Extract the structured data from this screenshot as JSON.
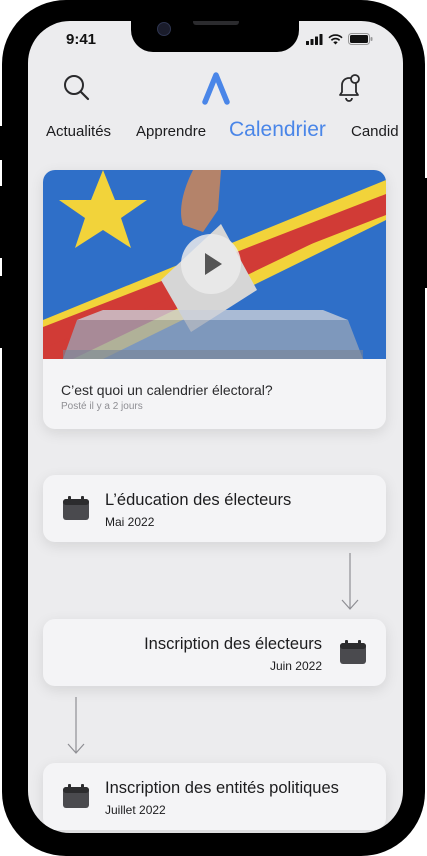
{
  "status": {
    "time": "9:41"
  },
  "header": {
    "search_icon": "search-icon",
    "logo_icon": "logo-icon",
    "bell_icon": "bell-icon"
  },
  "tabs": [
    {
      "label": "Actualités"
    },
    {
      "label": "Apprendre"
    },
    {
      "label": "Calendrier",
      "active": true
    },
    {
      "label": "Candid"
    }
  ],
  "video": {
    "title": "C’est quoi un calendrier électoral?",
    "meta": "Posté il y a 2 jours",
    "play_icon": "play-icon"
  },
  "events": [
    {
      "title": "L’éducation des électeurs",
      "date": "Mai 2022"
    },
    {
      "title": "Inscription des électeurs",
      "date": "Juin 2022"
    },
    {
      "title": "Inscription des entités politiques",
      "date": "Juillet 2022"
    }
  ],
  "colors": {
    "accent": "#4a86e8",
    "card": "#f4f4f6",
    "background": "#ececee"
  }
}
